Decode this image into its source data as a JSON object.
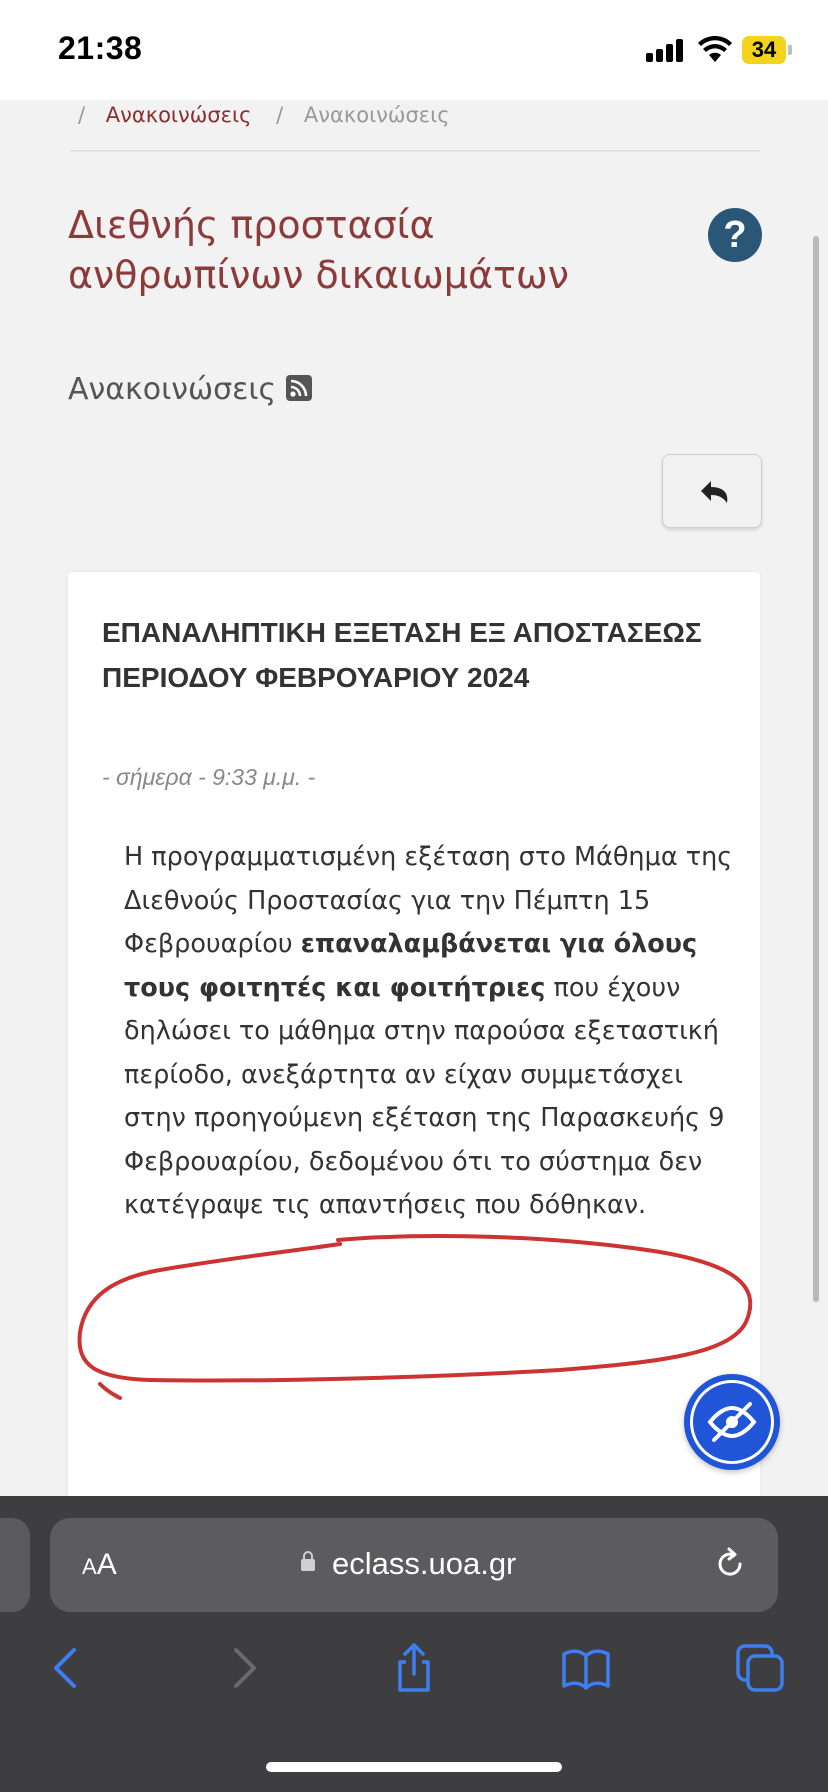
{
  "status_bar": {
    "time": "21:38",
    "battery": "34"
  },
  "breadcrumb": {
    "sep1": "/",
    "link": "Ανακοινώσεις",
    "sep2": "/",
    "current": "Ανακοινώσεις"
  },
  "course": {
    "title": "Διεθνής προστασία ανθρωπίνων δικαιωμάτων",
    "help_label": "?"
  },
  "section": {
    "subtitle": "Ανακοινώσεις"
  },
  "announcement": {
    "title": "ΕΠΑΝΑΛΗΠΤΙΚΗ ΕΞΕΤΑΣΗ ΕΞ ΑΠΟΣΤΑΣΕΩΣ ΠΕΡΙΟΔΟΥ ΦΕΒΡΟΥΑΡΙΟΥ 2024",
    "date": "- σήμερα - 9:33 μ.μ. -",
    "body_1": "Η προγραμματισμένη εξέταση στο Μάθημα της Διεθνούς Προστασίας για την Πέμπτη 15 Φεβρουαρίου ",
    "body_bold": "επαναλαμβάνεται για όλους τους φοιτητές και φοιτήτριες",
    "body_2": " που έχουν δηλώσει το μάθημα στην παρούσα εξεταστική περίοδο, ανεξάρτητα αν είχαν συμμετάσχει στην προηγούμενη εξέταση της Παρασκευής  9 Φεβρουαρίου, δεδομένου ότι το σύστημα δεν κατέγραψε τις απαντήσεις που δόθηκαν."
  },
  "browser": {
    "aa_small": "A",
    "aa_large": "A",
    "url": "eclass.uoa.gr"
  },
  "colors": {
    "accent_red": "#8c3a3a",
    "help_blue": "#2a5677",
    "annotation_red": "#cc3333",
    "accessibility_blue": "#1f55d6"
  },
  "icons": [
    "signal-icon",
    "wifi-icon",
    "battery-icon",
    "help-icon",
    "rss-icon",
    "reply-icon",
    "eye-slash-icon",
    "lock-icon",
    "reload-icon",
    "back-icon",
    "forward-icon",
    "share-icon",
    "bookmarks-icon",
    "tabs-icon"
  ]
}
